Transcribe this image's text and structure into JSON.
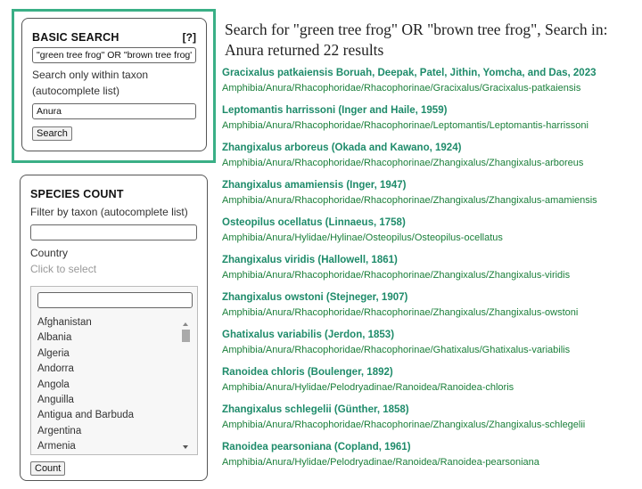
{
  "basic_search": {
    "title": "BASIC SEARCH",
    "help": "[?]",
    "query": "\"green tree frog\" OR \"brown tree frog\"",
    "taxon_label": "Search only within taxon (autocomplete list)",
    "taxon_value": "Anura",
    "search_button": "Search"
  },
  "species_count": {
    "title": "SPECIES COUNT",
    "filter_label": "Filter by taxon (autocomplete list)",
    "filter_value": "",
    "country_label": "Country",
    "country_hint": "Click to select",
    "country_search": "",
    "countries": [
      "Afghanistan",
      "Albania",
      "Algeria",
      "Andorra",
      "Angola",
      "Anguilla",
      "Antigua and Barbuda",
      "Argentina",
      "Armenia"
    ],
    "count_button": "Count"
  },
  "results": {
    "heading": "Search for \"green tree frog\" OR \"brown tree frog\", Search in: Anura returned 22 results",
    "items": [
      {
        "name": "Gracixalus patkaiensis Boruah, Deepak, Patel, Jithin, Yomcha, and Das, 2023",
        "path": "Amphibia/Anura/Rhacophoridae/Rhacophorinae/Gracixalus/Gracixalus-patkaiensis"
      },
      {
        "name": "Leptomantis harrissoni (Inger and Haile, 1959)",
        "path": "Amphibia/Anura/Rhacophoridae/Rhacophorinae/Leptomantis/Leptomantis-harrissoni"
      },
      {
        "name": "Zhangixalus arboreus (Okada and Kawano, 1924)",
        "path": "Amphibia/Anura/Rhacophoridae/Rhacophorinae/Zhangixalus/Zhangixalus-arboreus"
      },
      {
        "name": "Zhangixalus amamiensis (Inger, 1947)",
        "path": "Amphibia/Anura/Rhacophoridae/Rhacophorinae/Zhangixalus/Zhangixalus-amamiensis"
      },
      {
        "name": "Osteopilus ocellatus (Linnaeus, 1758)",
        "path": "Amphibia/Anura/Hylidae/Hylinae/Osteopilus/Osteopilus-ocellatus"
      },
      {
        "name": "Zhangixalus viridis (Hallowell, 1861)",
        "path": "Amphibia/Anura/Rhacophoridae/Rhacophorinae/Zhangixalus/Zhangixalus-viridis"
      },
      {
        "name": "Zhangixalus owstoni (Stejneger, 1907)",
        "path": "Amphibia/Anura/Rhacophoridae/Rhacophorinae/Zhangixalus/Zhangixalus-owstoni"
      },
      {
        "name": "Ghatixalus variabilis (Jerdon, 1853)",
        "path": "Amphibia/Anura/Rhacophoridae/Rhacophorinae/Ghatixalus/Ghatixalus-variabilis"
      },
      {
        "name": "Ranoidea chloris (Boulenger, 1892)",
        "path": "Amphibia/Anura/Hylidae/Pelodryadinae/Ranoidea/Ranoidea-chloris"
      },
      {
        "name": "Zhangixalus schlegelii (Günther, 1858)",
        "path": "Amphibia/Anura/Rhacophoridae/Rhacophorinae/Zhangixalus/Zhangixalus-schlegelii"
      },
      {
        "name": "Ranoidea pearsoniana (Copland, 1961)",
        "path": "Amphibia/Anura/Hylidae/Pelodryadinae/Ranoidea/Ranoidea-pearsoniana"
      }
    ]
  },
  "colors": {
    "highlight": "#3aaf86",
    "link": "#1e8b6a",
    "path": "#1a7f3a"
  }
}
